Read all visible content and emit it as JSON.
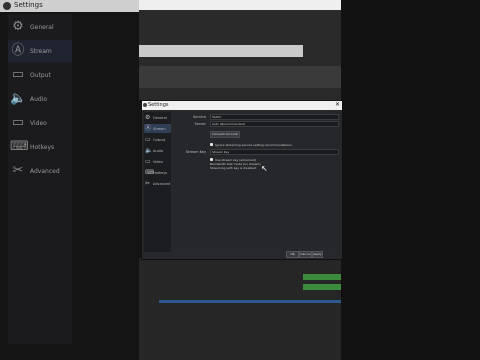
{
  "bg_window": {
    "title": "Settings",
    "sidebar": [
      {
        "label": "General",
        "icon": "gear-icon",
        "glyph": "⚙"
      },
      {
        "label": "Stream",
        "icon": "stream-icon",
        "glyph": "Ⓐ"
      },
      {
        "label": "Output",
        "icon": "output-icon",
        "glyph": "▭"
      },
      {
        "label": "Audio",
        "icon": "speaker-icon",
        "glyph": "🔈"
      },
      {
        "label": "Video",
        "icon": "monitor-icon",
        "glyph": "▭"
      },
      {
        "label": "Hotkeys",
        "icon": "keyboard-icon",
        "glyph": "⌨"
      },
      {
        "label": "Advanced",
        "icon": "tools-icon",
        "glyph": "✂"
      }
    ]
  },
  "dialog": {
    "title": "Settings",
    "close": "✕",
    "nav": [
      {
        "label": "General",
        "icon": "gear-icon",
        "glyph": "⚙"
      },
      {
        "label": "Stream",
        "icon": "stream-icon",
        "glyph": "Ⓐ"
      },
      {
        "label": "Output",
        "icon": "output-icon",
        "glyph": "▭"
      },
      {
        "label": "Audio",
        "icon": "speaker-icon",
        "glyph": "🔈"
      },
      {
        "label": "Video",
        "icon": "monitor-icon",
        "glyph": "▭"
      },
      {
        "label": "Hotkeys",
        "icon": "keyboard-icon",
        "glyph": "⌨"
      },
      {
        "label": "Advanced",
        "icon": "tools-icon",
        "glyph": "✂"
      }
    ],
    "form": {
      "service_label": "Service",
      "service_value": "Twitch",
      "server_label": "Server",
      "server_value": "Auto (Recommended)",
      "connect_button": "Connect Account",
      "ignore_label": "Ignore streaming service setting recommendations",
      "streamkey_label": "Stream Key",
      "streamkey_value": "Stream Key",
      "use_key_label": "Use stream key (advanced)",
      "note_line1": "Bandwidth test mode (no stream)",
      "note_line2": "Streaming with key is disabled"
    },
    "footer": {
      "ok": "OK",
      "cancel": "Cancel",
      "apply": "Apply"
    }
  },
  "colors": {
    "accent": "#2f3d55",
    "background": "#0a0a0a"
  }
}
